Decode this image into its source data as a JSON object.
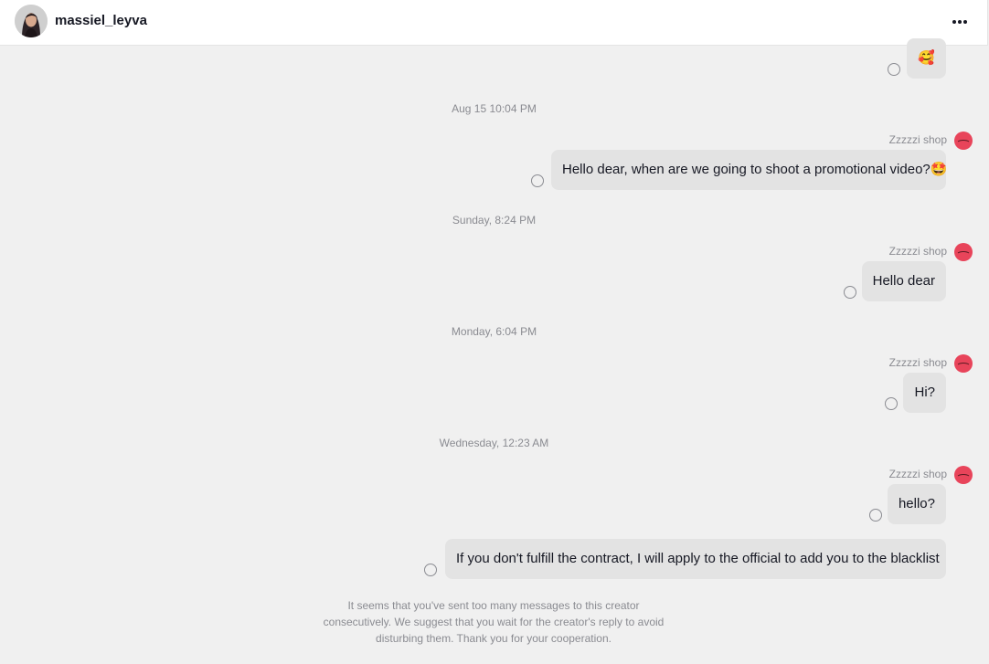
{
  "header": {
    "username": "massiel_leyva"
  },
  "messages": [
    {
      "type": "bubble",
      "text": "🥰"
    },
    {
      "type": "timestamp",
      "text": "Aug 15 10:04 PM"
    },
    {
      "type": "sender",
      "text": "Zzzzzi shop"
    },
    {
      "type": "bubble",
      "text": "Hello dear, when are we going to shoot a promotional video?🤩"
    },
    {
      "type": "timestamp",
      "text": "Sunday, 8:24 PM"
    },
    {
      "type": "sender",
      "text": "Zzzzzi shop"
    },
    {
      "type": "bubble",
      "text": "Hello dear"
    },
    {
      "type": "timestamp",
      "text": "Monday, 6:04 PM"
    },
    {
      "type": "sender",
      "text": "Zzzzzi shop"
    },
    {
      "type": "bubble",
      "text": "Hi?"
    },
    {
      "type": "timestamp",
      "text": "Wednesday, 12:23 AM"
    },
    {
      "type": "sender",
      "text": "Zzzzzi shop"
    },
    {
      "type": "bubble",
      "text": "hello?"
    },
    {
      "type": "bubble",
      "text": "If you don't fulfill the contract, I will apply to the official to add you to the blacklist"
    }
  ],
  "notice": "It seems that you've sent too many messages to this creator consecutively. We suggest that you wait for the creator's reply to avoid disturbing them. Thank you for your cooperation.",
  "colors": {
    "background": "#f0f0f0",
    "bubble": "#e3e3e3",
    "muted_text": "#8a8b91",
    "sender_avatar": "#e8445a"
  }
}
